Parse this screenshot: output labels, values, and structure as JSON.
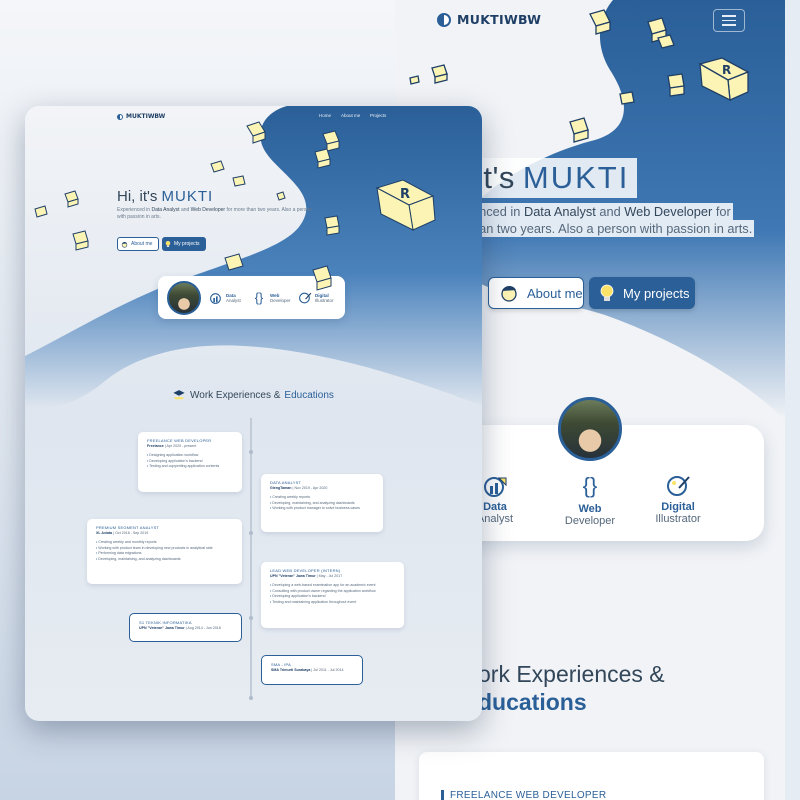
{
  "site": {
    "logo": "MUKTIWBW",
    "nav": [
      "Home",
      "About me",
      "Projects"
    ]
  },
  "hero": {
    "greeting": "Hi, it's",
    "name": "MUKTI",
    "desc_pre": "Experienced in",
    "role1": "Data Analyst",
    "and": "and",
    "role2": "Web Developer",
    "desc_post": "for more than two years. Also a person with passion in arts.",
    "about_btn": "About me",
    "projects_btn": "My projects"
  },
  "mobile_hero": {
    "greeting_partial": "it's",
    "name": "MUKTI",
    "line1_pre": "enced in",
    "role1": "Data Analyst",
    "and": "and",
    "role2": "Web Developer",
    "line1_post": "for",
    "line2": "han two years. Also a person with passion in arts."
  },
  "skills": [
    {
      "t1": "Data",
      "t2": "Analyst",
      "icon": "chart-icon"
    },
    {
      "t1": "Web",
      "t2": "Developer",
      "icon": "code-braces-icon"
    },
    {
      "t1": "Digital",
      "t2": "Illustrator",
      "icon": "palette-icon"
    }
  ],
  "section": {
    "work": "Work Experiences &",
    "edu": "Educations",
    "mobile_work": "ork Experiences &",
    "mobile_edu": "ducations"
  },
  "timeline": [
    {
      "title": "FREELANCE WEB DEVELOPER",
      "org": "Freelance",
      "date": "Apr 2020 - present",
      "items": [
        "Designing application workflow",
        "Developing application's backend",
        "Testing and copywriting application contents"
      ]
    },
    {
      "title": "DATA ANALYST",
      "org": "GiengTaman",
      "date": "Nov 2019 - Apr 2020",
      "items": [
        "Creating weekly reports",
        "Developing, maintaining, and analyzing dashboards",
        "Working with product manager to solve business cases"
      ]
    },
    {
      "title": "PREMIUM SEGMENT ANALYST",
      "org": "XL Axiata",
      "date": "Oct 2018 - Sep 2019",
      "items": [
        "Creating weekly and monthly reports",
        "Working with product team in developing new products in analytical side",
        "Performing data migrations",
        "Developing, maintaining, and analyzing dashboards"
      ]
    },
    {
      "title": "LEAD WEB DEVELOPER (INTERN)",
      "org": "UPN \"Veteran\" Jawa Timur",
      "date": "May - Jul 2017",
      "items": [
        "Developing a web-based examination app for an academic event",
        "Consulting with product owner regarding the application workflow",
        "Developing application's backend",
        "Testing and maintaining application throughout event"
      ]
    },
    {
      "title": "S1 TEKNIK INFORMATIKA",
      "org": "UPN \"Veteran\" Jawa Timur",
      "date": "Aug 2014 - Jun 2018",
      "items": []
    },
    {
      "title": "SMA - IPA",
      "org": "SMA Trimurti Surabaya",
      "date": "Jul 2011 - Jul 2014",
      "items": []
    }
  ],
  "mobile_timeline_first": "FREELANCE WEB DEVELOPER",
  "colors": {
    "brand": "#2a5f98",
    "cube": "#fbf4b4",
    "text": "#33475b"
  }
}
